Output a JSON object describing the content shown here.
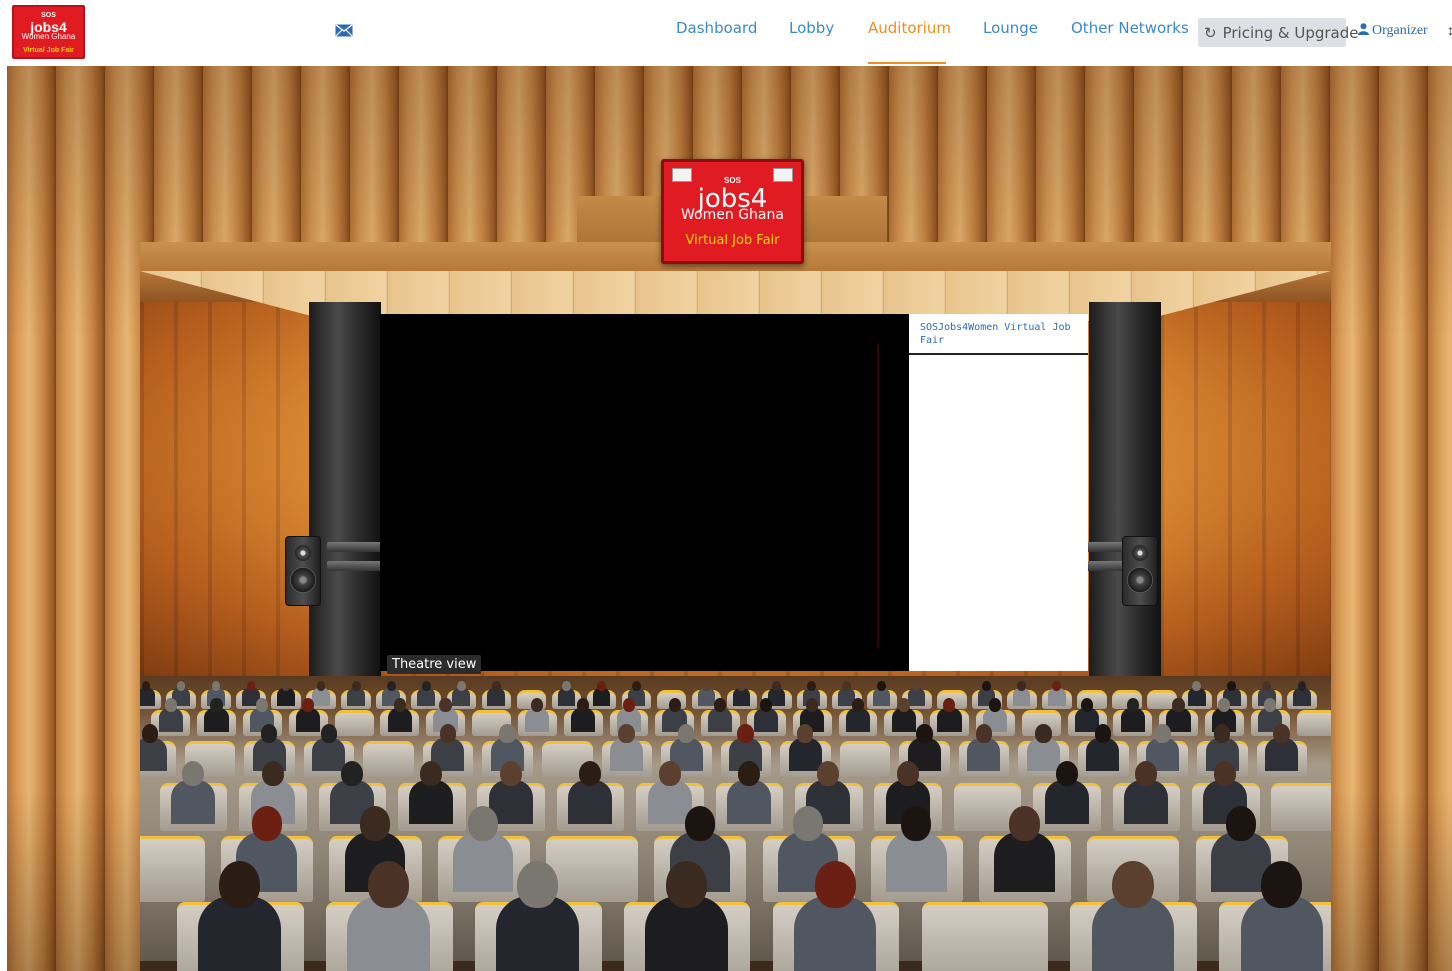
{
  "brand": {
    "logo_sos": "SOS",
    "logo_main": "jobs4",
    "logo_sub": "Women Ghana",
    "logo_tag": "Virtual Job Fair"
  },
  "nav": {
    "links": [
      {
        "label": "Dashboard",
        "active": false
      },
      {
        "label": "Lobby",
        "active": false
      },
      {
        "label": "Auditorium",
        "active": true
      },
      {
        "label": "Lounge",
        "active": false
      },
      {
        "label": "Other Networks",
        "active": false
      }
    ],
    "pricing_label": "Pricing & Upgrade",
    "organizer_label": "Organizer",
    "active_color": "#f28c1a",
    "link_color": "#3b8ac7"
  },
  "stage": {
    "sign_sos": "SOS",
    "sign_main": "jobs4",
    "sign_women": "Women Ghana",
    "sign_tag": "Virtual Job Fair",
    "theatre_label": "Theatre view",
    "chat_title": "SOSJobs4Women Virtual Job Fair"
  },
  "colors": {
    "brand_red": "#e11b22",
    "brand_yellow": "#ffd400"
  }
}
